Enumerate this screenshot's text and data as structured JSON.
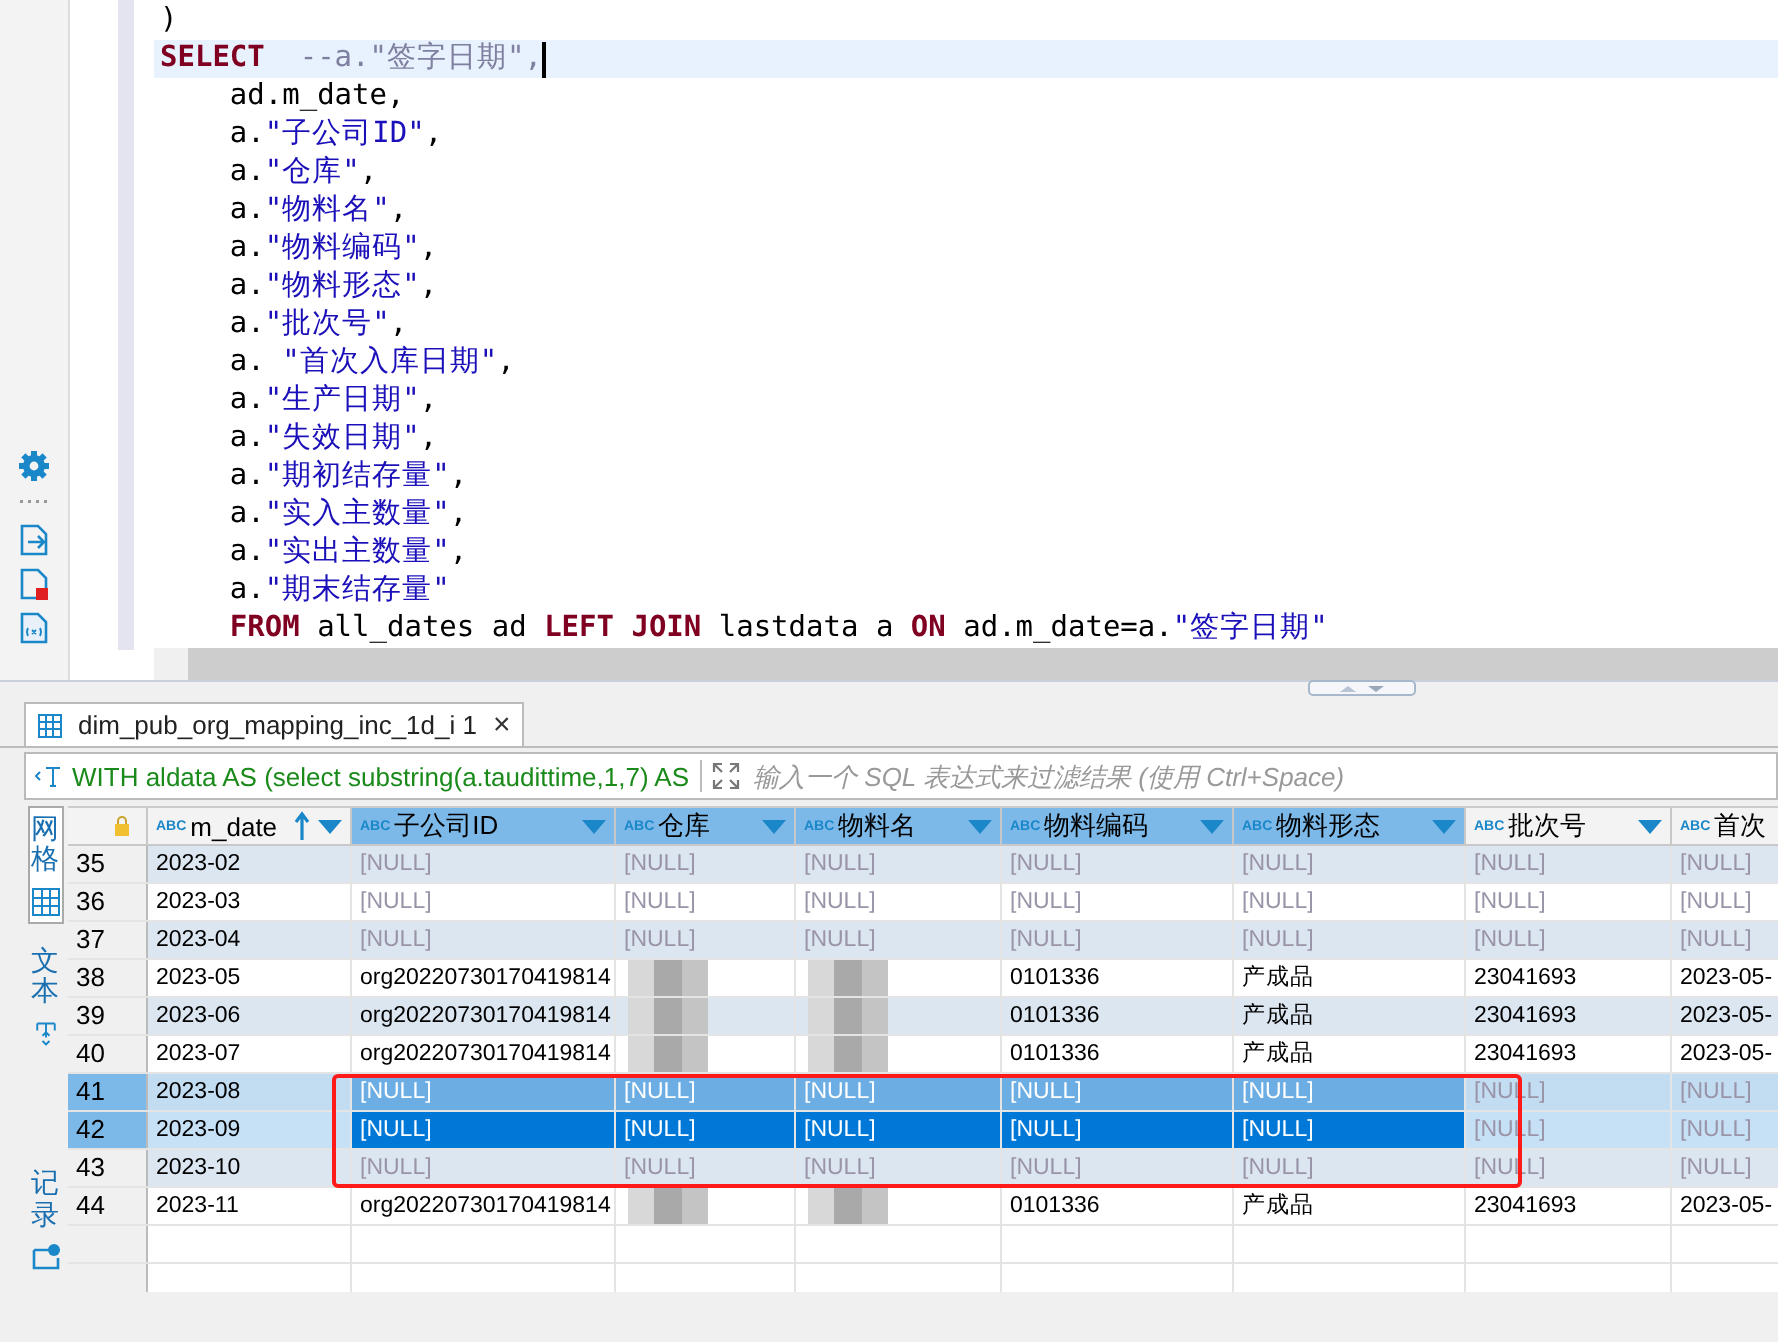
{
  "editor": {
    "lines": [
      {
        "current": false,
        "tokens": [
          {
            "t": ")",
            "kind": "plain"
          }
        ]
      },
      {
        "current": true,
        "tokens": [
          {
            "t": "SELECT",
            "kind": "keyword"
          },
          {
            "t": "  --a.\"签字日期\",",
            "kind": "comment"
          }
        ]
      },
      {
        "current": false,
        "tokens": [
          {
            "t": "    ad.m_date,",
            "kind": "plain"
          }
        ]
      },
      {
        "current": false,
        "tokens": [
          {
            "t": "    a.",
            "kind": "plain"
          },
          {
            "t": "\"子公司ID\"",
            "kind": "string"
          },
          {
            "t": ",",
            "kind": "plain"
          }
        ]
      },
      {
        "current": false,
        "tokens": [
          {
            "t": "    a.",
            "kind": "plain"
          },
          {
            "t": "\"仓库\"",
            "kind": "string"
          },
          {
            "t": ",",
            "kind": "plain"
          }
        ]
      },
      {
        "current": false,
        "tokens": [
          {
            "t": "    a.",
            "kind": "plain"
          },
          {
            "t": "\"物料名\"",
            "kind": "string"
          },
          {
            "t": ",",
            "kind": "plain"
          }
        ]
      },
      {
        "current": false,
        "tokens": [
          {
            "t": "    a.",
            "kind": "plain"
          },
          {
            "t": "\"物料编码\"",
            "kind": "string"
          },
          {
            "t": ",",
            "kind": "plain"
          }
        ]
      },
      {
        "current": false,
        "tokens": [
          {
            "t": "    a.",
            "kind": "plain"
          },
          {
            "t": "\"物料形态\"",
            "kind": "string"
          },
          {
            "t": ",",
            "kind": "plain"
          }
        ]
      },
      {
        "current": false,
        "tokens": [
          {
            "t": "    a.",
            "kind": "plain"
          },
          {
            "t": "\"批次号\"",
            "kind": "string"
          },
          {
            "t": ",",
            "kind": "plain"
          }
        ]
      },
      {
        "current": false,
        "tokens": [
          {
            "t": "    a. ",
            "kind": "plain"
          },
          {
            "t": "\"首次入库日期\"",
            "kind": "string"
          },
          {
            "t": ",",
            "kind": "plain"
          }
        ]
      },
      {
        "current": false,
        "tokens": [
          {
            "t": "    a.",
            "kind": "plain"
          },
          {
            "t": "\"生产日期\"",
            "kind": "string"
          },
          {
            "t": ",",
            "kind": "plain"
          }
        ]
      },
      {
        "current": false,
        "tokens": [
          {
            "t": "    a.",
            "kind": "plain"
          },
          {
            "t": "\"失效日期\"",
            "kind": "string"
          },
          {
            "t": ",",
            "kind": "plain"
          }
        ]
      },
      {
        "current": false,
        "tokens": [
          {
            "t": "    a.",
            "kind": "plain"
          },
          {
            "t": "\"期初结存量\"",
            "kind": "string"
          },
          {
            "t": ",",
            "kind": "plain"
          }
        ]
      },
      {
        "current": false,
        "tokens": [
          {
            "t": "    a.",
            "kind": "plain"
          },
          {
            "t": "\"实入主数量\"",
            "kind": "string"
          },
          {
            "t": ",",
            "kind": "plain"
          }
        ]
      },
      {
        "current": false,
        "tokens": [
          {
            "t": "    a.",
            "kind": "plain"
          },
          {
            "t": "\"实出主数量\"",
            "kind": "string"
          },
          {
            "t": ",",
            "kind": "plain"
          }
        ]
      },
      {
        "current": false,
        "tokens": [
          {
            "t": "    a.",
            "kind": "plain"
          },
          {
            "t": "\"期末结存量\"",
            "kind": "string"
          }
        ]
      },
      {
        "current": false,
        "tokens": [
          {
            "t": "    FROM",
            "kind": "keyword"
          },
          {
            "t": " all_dates ad ",
            "kind": "plain"
          },
          {
            "t": "LEFT JOIN",
            "kind": "keyword"
          },
          {
            "t": " lastdata a ",
            "kind": "plain"
          },
          {
            "t": "ON",
            "kind": "keyword"
          },
          {
            "t": " ad.m_date=a.",
            "kind": "plain"
          },
          {
            "t": "\"签字日期\"",
            "kind": "string"
          }
        ]
      }
    ]
  },
  "results": {
    "tab": {
      "label": "dim_pub_org_mapping_inc_1d_i 1",
      "close": "×",
      "selected": true
    },
    "query": "WITH aldata AS (select substring(a.taudittime,1,7) AS",
    "filter": {
      "placeholder": "输入一个 SQL 表达式来过滤结果 (使用 Ctrl+Space)"
    },
    "views": [
      {
        "label": "网格",
        "selected": true,
        "kind": "grid"
      },
      {
        "label": "文本",
        "selected": false,
        "kind": "text"
      },
      {
        "label": "记录",
        "selected": false,
        "kind": "record"
      }
    ],
    "columns": [
      {
        "type": "ABC",
        "name": "m_date",
        "selected": false,
        "sorted": true
      },
      {
        "type": "ABC",
        "name": "子公司ID",
        "selected": true,
        "sorted": false
      },
      {
        "type": "ABC",
        "name": "仓库",
        "selected": true,
        "sorted": false
      },
      {
        "type": "ABC",
        "name": "物料名",
        "selected": true,
        "sorted": false
      },
      {
        "type": "ABC",
        "name": "物料编码",
        "selected": true,
        "sorted": false
      },
      {
        "type": "ABC",
        "name": "物料形态",
        "selected": true,
        "sorted": false
      },
      {
        "type": "ABC",
        "name": "批次号",
        "selected": false,
        "sorted": false
      },
      {
        "type": "ABC",
        "name": "首次",
        "selected": false,
        "sorted": false
      }
    ],
    "rows": [
      {
        "num": "35",
        "selected": false,
        "current": false,
        "cells": [
          {
            "kind": "value",
            "text": "2023-02"
          },
          {
            "kind": "null",
            "text": "[NULL]"
          },
          {
            "kind": "null",
            "text": "[NULL]"
          },
          {
            "kind": "null",
            "text": "[NULL]"
          },
          {
            "kind": "null",
            "text": "[NULL]"
          },
          {
            "kind": "null",
            "text": "[NULL]"
          },
          {
            "kind": "null",
            "text": "[NULL]"
          },
          {
            "kind": "null",
            "text": "[NULL]"
          }
        ]
      },
      {
        "num": "36",
        "selected": false,
        "current": false,
        "cells": [
          {
            "kind": "value",
            "text": "2023-03"
          },
          {
            "kind": "null",
            "text": "[NULL]"
          },
          {
            "kind": "null",
            "text": "[NULL]"
          },
          {
            "kind": "null",
            "text": "[NULL]"
          },
          {
            "kind": "null",
            "text": "[NULL]"
          },
          {
            "kind": "null",
            "text": "[NULL]"
          },
          {
            "kind": "null",
            "text": "[NULL]"
          },
          {
            "kind": "null",
            "text": "[NULL]"
          }
        ]
      },
      {
        "num": "37",
        "selected": false,
        "current": false,
        "cells": [
          {
            "kind": "value",
            "text": "2023-04"
          },
          {
            "kind": "null",
            "text": "[NULL]"
          },
          {
            "kind": "null",
            "text": "[NULL]"
          },
          {
            "kind": "null",
            "text": "[NULL]"
          },
          {
            "kind": "null",
            "text": "[NULL]"
          },
          {
            "kind": "null",
            "text": "[NULL]"
          },
          {
            "kind": "null",
            "text": "[NULL]"
          },
          {
            "kind": "null",
            "text": "[NULL]"
          }
        ]
      },
      {
        "num": "38",
        "selected": false,
        "current": false,
        "cells": [
          {
            "kind": "value",
            "text": "2023-05"
          },
          {
            "kind": "value",
            "text": "org20220730170419814"
          },
          {
            "kind": "redacted"
          },
          {
            "kind": "redacted"
          },
          {
            "kind": "value",
            "text": "0101336"
          },
          {
            "kind": "value",
            "text": "产成品"
          },
          {
            "kind": "value",
            "text": "23041693"
          },
          {
            "kind": "value",
            "text": "2023-05-"
          }
        ]
      },
      {
        "num": "39",
        "selected": false,
        "current": false,
        "cells": [
          {
            "kind": "value",
            "text": "2023-06"
          },
          {
            "kind": "value",
            "text": "org20220730170419814"
          },
          {
            "kind": "redacted"
          },
          {
            "kind": "redacted"
          },
          {
            "kind": "value",
            "text": "0101336"
          },
          {
            "kind": "value",
            "text": "产成品"
          },
          {
            "kind": "value",
            "text": "23041693"
          },
          {
            "kind": "value",
            "text": "2023-05-"
          }
        ]
      },
      {
        "num": "40",
        "selected": false,
        "current": false,
        "cells": [
          {
            "kind": "value",
            "text": "2023-07"
          },
          {
            "kind": "value",
            "text": "org20220730170419814"
          },
          {
            "kind": "redacted"
          },
          {
            "kind": "redacted"
          },
          {
            "kind": "value",
            "text": "0101336"
          },
          {
            "kind": "value",
            "text": "产成品"
          },
          {
            "kind": "value",
            "text": "23041693"
          },
          {
            "kind": "value",
            "text": "2023-05-"
          }
        ]
      },
      {
        "num": "41",
        "selected": true,
        "current": false,
        "cells": [
          {
            "kind": "value",
            "text": "2023-08"
          },
          {
            "kind": "null",
            "text": "[NULL]"
          },
          {
            "kind": "null",
            "text": "[NULL]"
          },
          {
            "kind": "null",
            "text": "[NULL]"
          },
          {
            "kind": "null",
            "text": "[NULL]"
          },
          {
            "kind": "null",
            "text": "[NULL]"
          },
          {
            "kind": "null",
            "text": "[NULL]"
          },
          {
            "kind": "null",
            "text": "[NULL]"
          }
        ]
      },
      {
        "num": "42",
        "selected": true,
        "current": true,
        "cells": [
          {
            "kind": "value",
            "text": "2023-09"
          },
          {
            "kind": "null",
            "text": "[NULL]"
          },
          {
            "kind": "null",
            "text": "[NULL]"
          },
          {
            "kind": "null",
            "text": "[NULL]"
          },
          {
            "kind": "null",
            "text": "[NULL]"
          },
          {
            "kind": "null",
            "text": "[NULL]"
          },
          {
            "kind": "null",
            "text": "[NULL]"
          },
          {
            "kind": "null",
            "text": "[NULL]"
          }
        ]
      },
      {
        "num": "43",
        "selected": false,
        "current": false,
        "cells": [
          {
            "kind": "value",
            "text": "2023-10"
          },
          {
            "kind": "null",
            "text": "[NULL]"
          },
          {
            "kind": "null",
            "text": "[NULL]"
          },
          {
            "kind": "null",
            "text": "[NULL]"
          },
          {
            "kind": "null",
            "text": "[NULL]"
          },
          {
            "kind": "null",
            "text": "[NULL]"
          },
          {
            "kind": "null",
            "text": "[NULL]"
          },
          {
            "kind": "null",
            "text": "[NULL]"
          }
        ]
      },
      {
        "num": "44",
        "selected": false,
        "current": false,
        "cells": [
          {
            "kind": "value",
            "text": "2023-11"
          },
          {
            "kind": "value",
            "text": "org20220730170419814"
          },
          {
            "kind": "redacted"
          },
          {
            "kind": "redacted"
          },
          {
            "kind": "value",
            "text": "0101336"
          },
          {
            "kind": "value",
            "text": "产成品"
          },
          {
            "kind": "value",
            "text": "23041693"
          },
          {
            "kind": "value",
            "text": "2023-05-"
          }
        ]
      }
    ],
    "annotations": [
      {
        "kind": "rectangle"
      }
    ]
  }
}
